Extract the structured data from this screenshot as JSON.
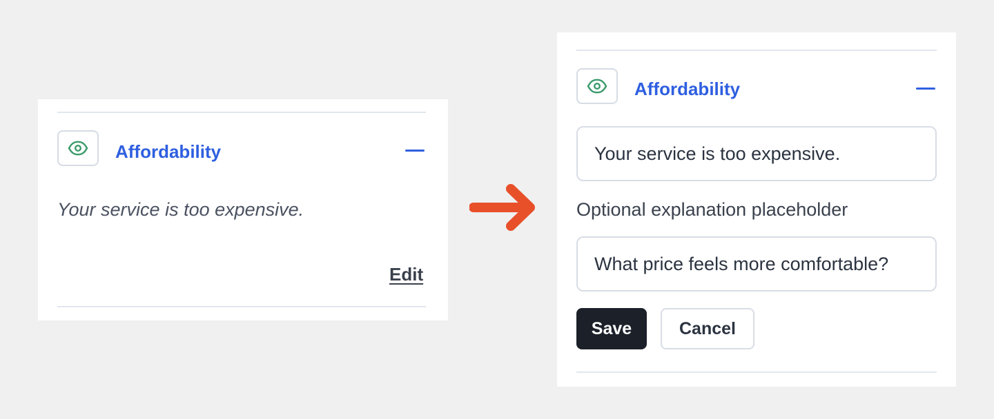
{
  "before": {
    "category_icon": "eye-icon",
    "title": "Affordability",
    "collapse_icon": "minus-icon",
    "statement": "Your service is too expensive.",
    "edit_label": "Edit"
  },
  "arrow_icon": "arrow-right-icon",
  "after": {
    "category_icon": "eye-icon",
    "title": "Affordability",
    "collapse_icon": "minus-icon",
    "statement_value": "Your service is too expensive.",
    "explanation_label": "Optional explanation placeholder",
    "explanation_value": "What price feels more comfortable?",
    "save_label": "Save",
    "cancel_label": "Cancel"
  },
  "colors": {
    "background": "#f0f0f0",
    "accent_blue": "#2f5fe0",
    "icon_green": "#3a9a6a",
    "arrow_orange": "#e8502a",
    "button_dark": "#1c2029"
  }
}
